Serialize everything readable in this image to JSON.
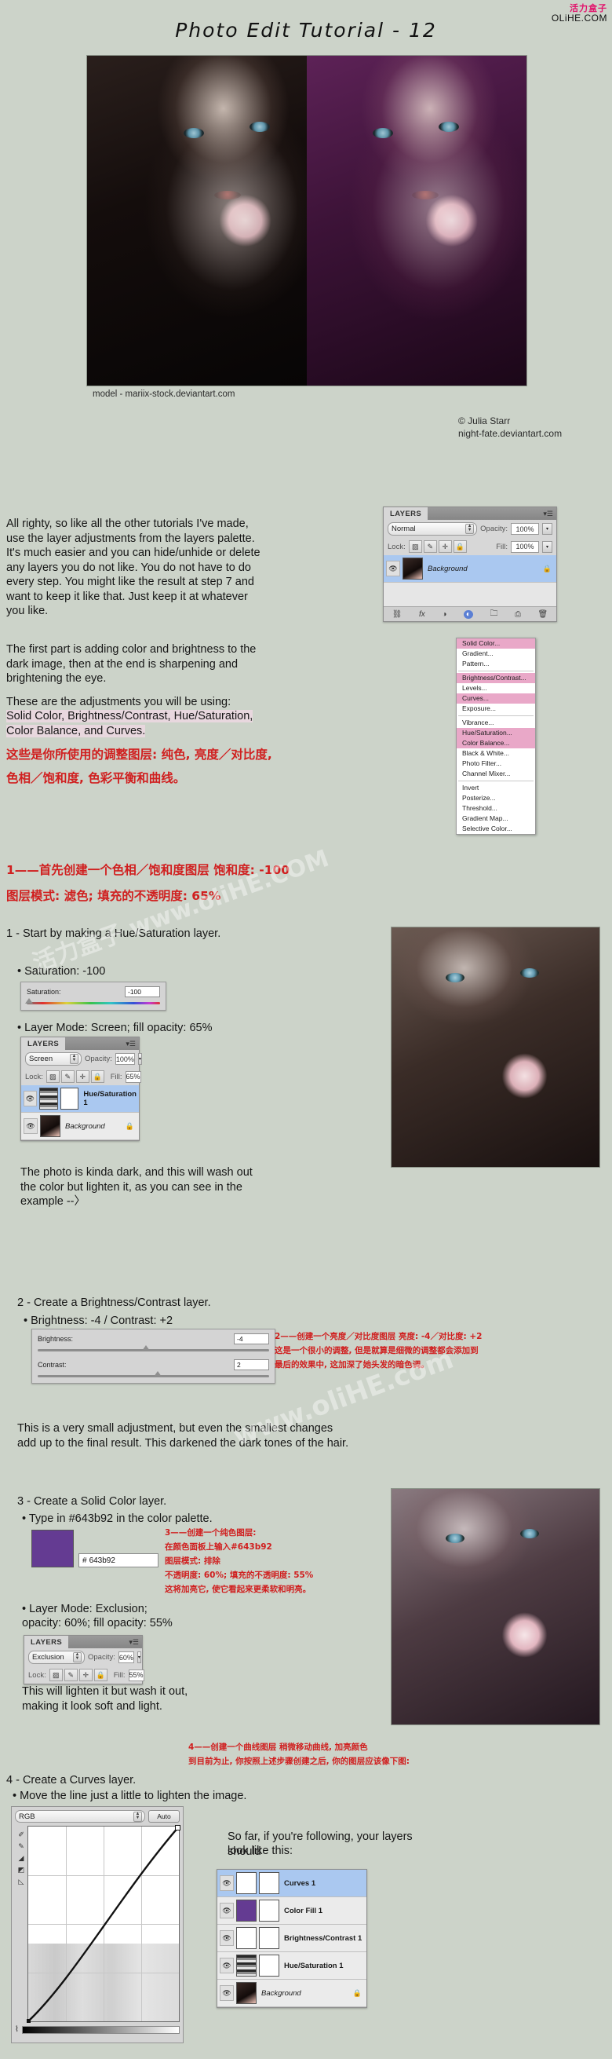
{
  "header": {
    "title": "Photo Edit Tutorial - 12",
    "brand_cn": "活力盒子",
    "brand_en": "OLiHE.COM"
  },
  "hero": {
    "caption": "model - mariix-stock.deviantart.com",
    "copyright_line1": "© Julia Starr",
    "copyright_line2": "night-fate.deviantart.com"
  },
  "intro": {
    "p1": "All righty, so like all the other tutorials I've made, use the layer adjustments from the layers palette. It's much easier and you can hide/unhide or delete any layers you do not like. You do not have to do every step. You might like the result at step 7 and want to keep it like that. Just keep it at whatever you like.",
    "p2": "The first part is adding color and brightness to the dark image, then at the end is sharpening and brightening the eye.",
    "p3_lead": "These are the adjustments you will be using:",
    "p3_list": "Solid Color, Brightness/Contrast, Hue/Saturation, Color Balance, and Curves.",
    "cn_line1": "这些是你所使用的调整图层: 纯色, 亮度／对比度,",
    "cn_line2": "色相／饱和度, 色彩平衡和曲线。"
  },
  "layers_palette_intro": {
    "tab": "LAYERS",
    "blend_mode": "Normal",
    "opacity_label": "Opacity:",
    "opacity_value": "100%",
    "lock_label": "Lock:",
    "fill_label": "Fill:",
    "fill_value": "100%",
    "layer_name": "Background",
    "lock_icon": "lock-icon"
  },
  "adjustment_menu": {
    "items": [
      {
        "label": "Solid Color...",
        "highlighted": true
      },
      {
        "label": "Gradient...",
        "highlighted": false
      },
      {
        "label": "Pattern...",
        "highlighted": false
      },
      {
        "separator": true
      },
      {
        "label": "Brightness/Contrast...",
        "highlighted": true
      },
      {
        "label": "Levels...",
        "highlighted": false
      },
      {
        "label": "Curves...",
        "highlighted": true
      },
      {
        "label": "Exposure...",
        "highlighted": false
      },
      {
        "separator": true
      },
      {
        "label": "Vibrance...",
        "highlighted": false
      },
      {
        "label": "Hue/Saturation...",
        "highlighted": true
      },
      {
        "label": "Color Balance...",
        "highlighted": true
      },
      {
        "label": "Black & White...",
        "highlighted": false
      },
      {
        "label": "Photo Filter...",
        "highlighted": false
      },
      {
        "label": "Channel Mixer...",
        "highlighted": false
      },
      {
        "separator": true
      },
      {
        "label": "Invert",
        "highlighted": false
      },
      {
        "label": "Posterize...",
        "highlighted": false
      },
      {
        "label": "Threshold...",
        "highlighted": false
      },
      {
        "label": "Gradient Map...",
        "highlighted": false
      },
      {
        "label": "Selective Color...",
        "highlighted": false
      }
    ]
  },
  "step1": {
    "cn_line1": "1——首先创建一个色相／饱和度图层 饱和度: -100",
    "cn_line2": "图层模式: 滤色; 填充的不透明度: 65%",
    "heading": "1 - Start by making a Hue/Saturation layer.",
    "bullet1": "• Saturation: -100",
    "slider_label": "Saturation:",
    "slider_value": "-100",
    "bullet2": "• Layer Mode: Screen; fill opacity: 65%",
    "panel": {
      "tab": "LAYERS",
      "blend_mode": "Screen",
      "opacity_label": "Opacity:",
      "opacity_value": "100%",
      "lock_label": "Lock:",
      "fill_label": "Fill:",
      "fill_value": "65%",
      "layer1": "Hue/Saturation 1",
      "layer2": "Background"
    },
    "after_text": "The photo is kinda dark, and this will wash out the color but lighten it, as you can see in the example --〉"
  },
  "step2": {
    "heading": "2 - Create a Brightness/Contrast layer.",
    "bullet": "• Brightness: -4 /  Contrast: +2",
    "brightness_label": "Brightness:",
    "brightness_value": "-4",
    "contrast_label": "Contrast:",
    "contrast_value": "2",
    "cn_line1": "2——创建一个亮度／对比度图层  亮度: -4／对比度: +2",
    "cn_line2": "这是一个很小的调整, 但是就算是细微的调整都会添加到",
    "cn_line3": "最后的效果中, 这加深了她头发的暗色调。",
    "after_text": "This is a very small adjustment, but even the smallest changes add up to the final result. This darkened the dark tones of the hair."
  },
  "step3": {
    "heading": "3 - Create a Solid Color layer.",
    "bullet1": "• Type in #643b92 in the color palette.",
    "hex_prefix": "#",
    "hex_value": "643b92",
    "swatch_color": "#643b92",
    "cn_line1": "3——创建一个纯色图层:",
    "cn_line2": "在颜色面板上输入#643b92",
    "cn_line3": "图层模式: 排除",
    "cn_line4": "不透明度: 60%; 填充的不透明度: 55%",
    "cn_line5": "这将加亮它, 使它看起来更柔软和明亮。",
    "bullet2": "• Layer Mode: Exclusion;",
    "bullet3": "opacity: 60%; fill opacity: 55%",
    "panel": {
      "tab": "LAYERS",
      "blend_mode": "Exclusion",
      "opacity_label": "Opacity:",
      "opacity_value": "60%",
      "lock_label": "Lock:",
      "fill_label": "Fill:",
      "fill_value": "55%"
    },
    "after_text": "This will lighten it but wash it out, making it look soft and light."
  },
  "step4": {
    "heading": "4 - Create a Curves layer.",
    "bullet": "• Move the line just a little to lighten the image.",
    "cn_line1": "4——创建一个曲线图层  稍微移动曲线, 加亮颜色",
    "cn_line2": "到目前为止, 你按照上述步骤创建之后, 你的图层应该像下图:",
    "channel": "RGB",
    "auto_button": "Auto",
    "after_text_line1": "So far, if you're following, your layers should",
    "after_text_line2": "look like this:",
    "layer_stack": [
      {
        "name": "Curves 1",
        "thumb": "curve"
      },
      {
        "name": "Color Fill 1",
        "thumb": "solid"
      },
      {
        "name": "Brightness/Contrast 1",
        "thumb": "bc"
      },
      {
        "name": "Hue/Saturation 1",
        "thumb": "grad"
      },
      {
        "name": "Background",
        "thumb": "photo"
      }
    ]
  },
  "watermarks": {
    "wm1": "活力盒子 www.oliHE.COM",
    "wm2": "www.oliHE.com"
  },
  "icons": {
    "eye": "eye-icon",
    "lock": "lock-icon",
    "link": "link-icon",
    "fx": "fx-icon",
    "mask": "mask-icon",
    "adjustment": "adjustment-icon",
    "folder": "folder-icon",
    "newlayer": "new-layer-icon",
    "trash": "trash-icon",
    "panel_menu": "panel-menu-icon"
  }
}
